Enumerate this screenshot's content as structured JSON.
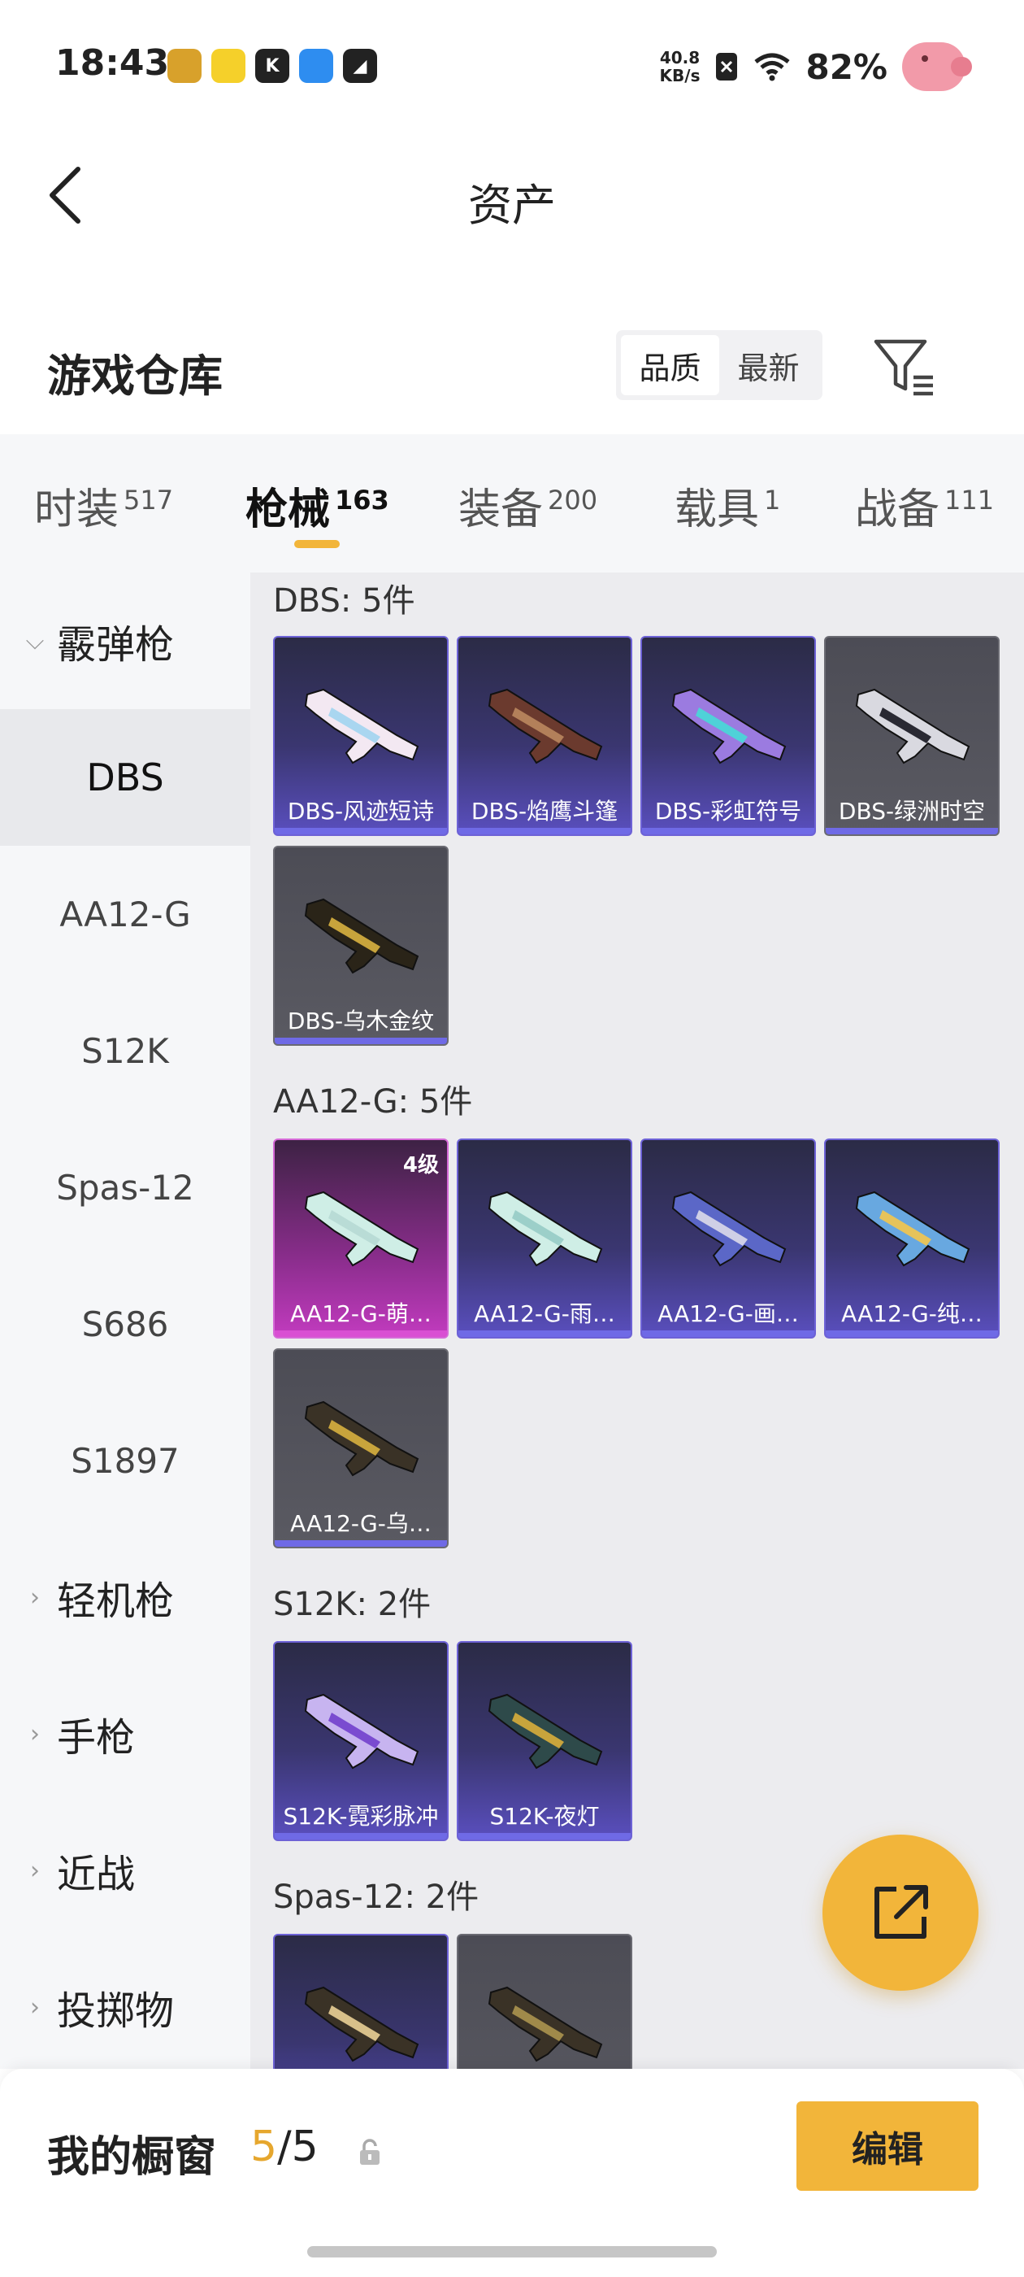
{
  "status_bar": {
    "time": "18:43",
    "net_speed_value": "40.8",
    "net_speed_unit": "KB/s",
    "battery": "82%"
  },
  "header": {
    "title": "资产"
  },
  "warehouse": {
    "title": "游戏仓库",
    "sort_options": [
      "品质",
      "最新"
    ],
    "sort_selected": "品质"
  },
  "categories": [
    {
      "label": "时装",
      "count": "517"
    },
    {
      "label": "枪械",
      "count": "163",
      "active": true
    },
    {
      "label": "装备",
      "count": "200"
    },
    {
      "label": "载具",
      "count": "1"
    },
    {
      "label": "战备",
      "count": "111"
    }
  ],
  "sidebar": {
    "group_shotgun": "霰弹枪",
    "items": [
      "DBS",
      "AA12-G",
      "S12K",
      "Spas-12",
      "S686",
      "S1897"
    ],
    "active_item": "DBS",
    "groups": [
      "轻机枪",
      "手枪",
      "近战",
      "投掷物"
    ]
  },
  "sections": [
    {
      "title": "DBS: 5件",
      "cards": [
        {
          "name": "DBS-风迹短诗",
          "rarity": "purple"
        },
        {
          "name": "DBS-焰鹰斗篷",
          "rarity": "purple"
        },
        {
          "name": "DBS-彩虹符号",
          "rarity": "purple"
        },
        {
          "name": "DBS-绿洲时空",
          "rarity": "grey"
        },
        {
          "name": "DBS-乌木金纹",
          "rarity": "grey"
        }
      ]
    },
    {
      "title": "AA12-G: 5件",
      "cards": [
        {
          "name": "AA12-G-萌…",
          "rarity": "pink",
          "level": "4级"
        },
        {
          "name": "AA12-G-雨…",
          "rarity": "purple"
        },
        {
          "name": "AA12-G-画…",
          "rarity": "purple"
        },
        {
          "name": "AA12-G-纯…",
          "rarity": "purple"
        },
        {
          "name": "AA12-G-乌…",
          "rarity": "grey"
        }
      ]
    },
    {
      "title": "S12K: 2件",
      "cards": [
        {
          "name": "S12K-霓彩脉冲",
          "rarity": "purple"
        },
        {
          "name": "S12K-夜灯",
          "rarity": "purple"
        }
      ]
    },
    {
      "title": "Spas-12: 2件",
      "cards": [
        {
          "name": "",
          "rarity": "purple"
        },
        {
          "name": "",
          "rarity": "grey"
        }
      ]
    }
  ],
  "bottom_bar": {
    "showcase_label": "我的橱窗",
    "showcase_current": "5",
    "showcase_sep": "/",
    "showcase_total": "5",
    "edit_label": "编辑"
  },
  "colors": {
    "accent": "#f2b53a",
    "purple_rarity": "#6d62d6",
    "pink_rarity": "#d56ad7",
    "grey_rarity": "#6a6a72"
  }
}
